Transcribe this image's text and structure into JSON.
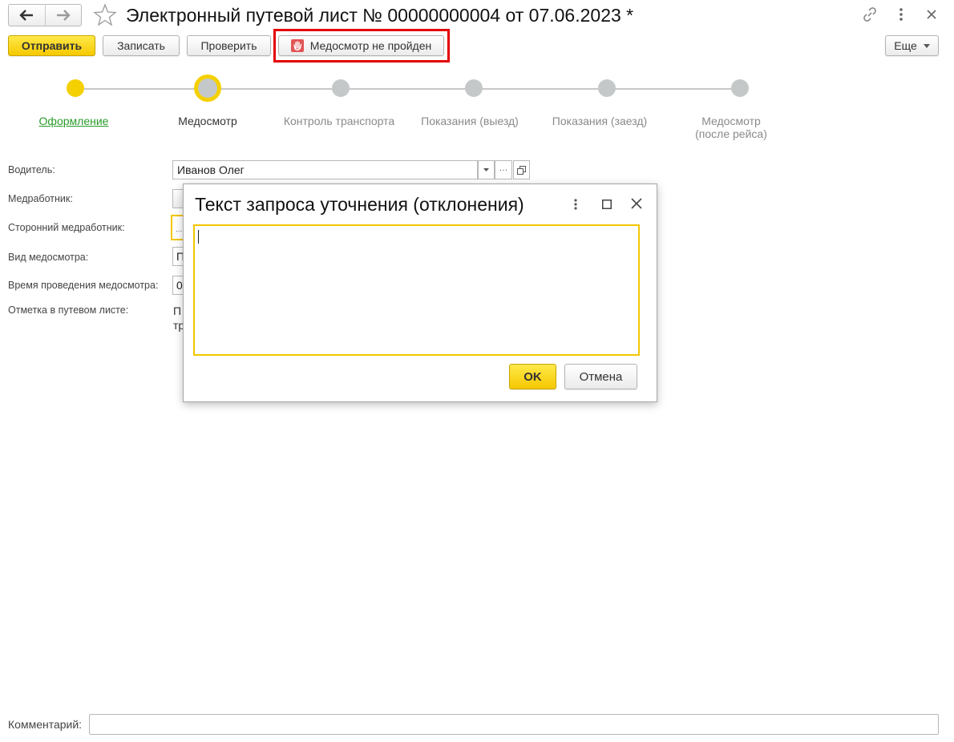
{
  "header": {
    "title": "Электронный путевой лист № 00000000004 от 07.06.2023 *"
  },
  "toolbar": {
    "send": "Отправить",
    "write": "Записать",
    "check": "Проверить",
    "med_failed": "Медосмотр не пройден",
    "more": "Еще"
  },
  "steps": [
    {
      "label": "Оформление"
    },
    {
      "label": "Медосмотр"
    },
    {
      "label": "Контроль транспорта"
    },
    {
      "label": "Показания (выезд)"
    },
    {
      "label": "Показания (заезд)"
    },
    {
      "label": "Медосмотр",
      "label2": "(после рейса)"
    }
  ],
  "form": {
    "driver_label": "Водитель:",
    "driver_value": "Иванов Олег",
    "medic_label": "Медработник:",
    "ext_medic_label": "Сторонний медработник:",
    "ext_medic_value": "...",
    "exam_type_label": "Вид медосмотра:",
    "exam_type_value": "П",
    "exam_time_label": "Время проведения медосмотра:",
    "exam_time_value": "0",
    "mark_label": "Отметка в путевом листе:",
    "mark_value_1": "П",
    "mark_value_2": "тр",
    "comment_label": "Комментарий:",
    "comment_value": ""
  },
  "dialog": {
    "title": "Текст запроса уточнения (отклонения)",
    "text_value": "",
    "ok": "OK",
    "cancel": "Отмена"
  },
  "colors": {
    "accent_yellow": "#f5c800",
    "done_green": "#2a9b2a",
    "highlight_red": "#e30000",
    "step_gray": "#c4c8c9"
  }
}
